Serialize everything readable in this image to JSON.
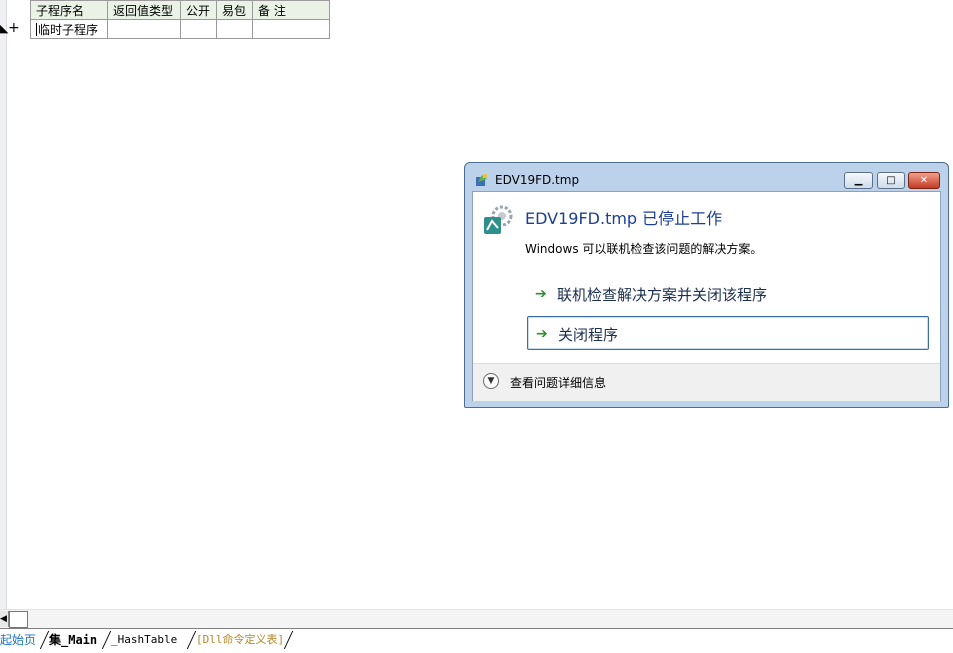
{
  "sub_table": {
    "headers": [
      "子程序名",
      "返回值类型",
      "公开",
      "易包",
      "备 注"
    ],
    "rows": [
      [
        "临时子程序",
        "",
        "",
        "",
        ""
      ]
    ]
  },
  "gutter": {
    "plus": "+"
  },
  "tabs": [
    "起始页",
    "集_Main",
    "_HashTable",
    "[Dll命令定义表]"
  ],
  "dialog": {
    "title": "EDV19FD.tmp",
    "headline": "EDV19FD.tmp 已停止工作",
    "description": "Windows 可以联机检查该问题的解决方案。",
    "options": [
      "联机检查解决方案并关闭该程序",
      "关闭程序"
    ],
    "details_label": "查看问题详细信息"
  },
  "colors": {
    "headline": "#1c3f94",
    "arrow": "#2d8f2d",
    "tab_active_link": "#1a73c9"
  }
}
